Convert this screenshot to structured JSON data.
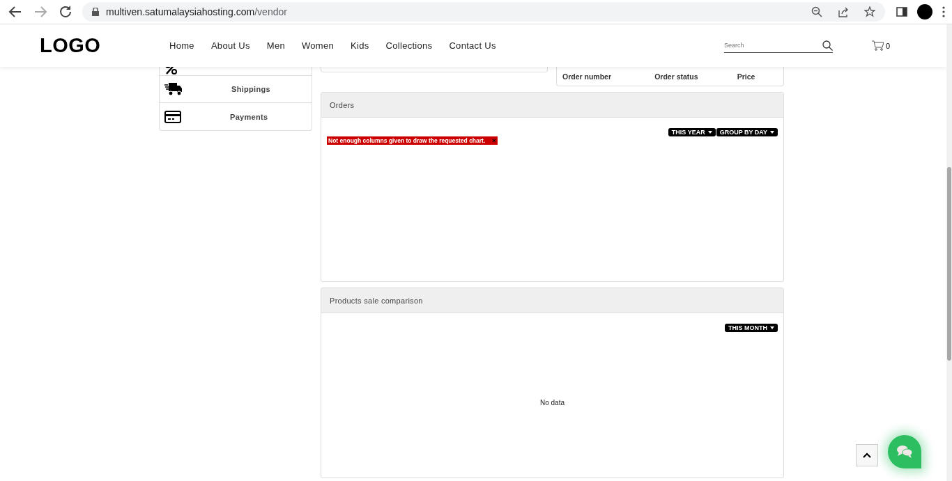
{
  "browser": {
    "url_host": "multiven.satumalaysiahosting.com",
    "url_path": "/vendor"
  },
  "header": {
    "logo": "LOGO",
    "nav": [
      "Home",
      "About Us",
      "Men",
      "Women",
      "Kids",
      "Collections",
      "Contact Us"
    ],
    "search": {
      "placeholder": "Search"
    },
    "cart_count": "0"
  },
  "sidebar": {
    "items": [
      {
        "kind": "discount"
      },
      {
        "kind": "shipping",
        "label": "Shippings"
      },
      {
        "kind": "payment",
        "label": "Payments"
      }
    ]
  },
  "latest_orders": {
    "columns": [
      "Order number",
      "Order status",
      "Price"
    ]
  },
  "orders_panel": {
    "title": "Orders",
    "dropdowns": [
      "THIS YEAR",
      "GROUP BY DAY"
    ],
    "error": "Not enough columns given to draw the requested chart.",
    "error_close": "×"
  },
  "products_panel": {
    "title": "Products sale comparison",
    "dropdowns": [
      "THIS MONTH"
    ],
    "empty_text": "No data"
  }
}
